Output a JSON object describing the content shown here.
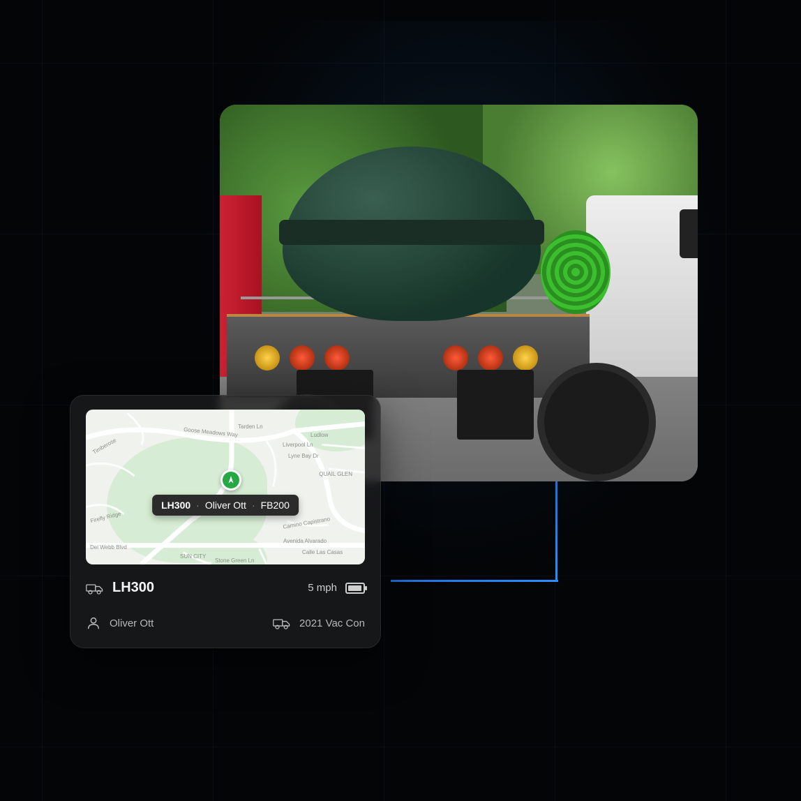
{
  "map": {
    "pin_tooltip": {
      "vehicle": "LH300",
      "driver": "Oliver Ott",
      "tag": "FB200"
    },
    "labels": {
      "sun_city": "SUN CITY",
      "quail_glen": "QUAIL GLEN",
      "firefly": "Firefly Ridge",
      "delwebb": "Del Webb Blvd",
      "goose": "Goose Meadows Way",
      "liverpool": "Liverpool Ln",
      "lynebay": "Lyne Bay Dr",
      "tarden": "Tarden Ln",
      "ludlow": "Ludlow",
      "timberose": "Timberose",
      "capistrano": "Camino Capistrano",
      "avenida": "Avenida Alvarado",
      "calle": "Calle Las Casas",
      "stonegreen": "Stone Green Ln"
    }
  },
  "card": {
    "vehicle_id": "LH300",
    "speed": "5 mph",
    "driver": "Oliver Ott",
    "vehicle_model": "2021 Vac Con"
  }
}
